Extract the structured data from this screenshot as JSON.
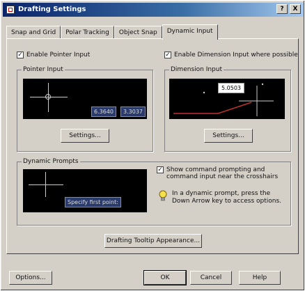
{
  "window": {
    "title": "Drafting Settings",
    "help_btn": "?",
    "close_btn": "X"
  },
  "tabs": [
    {
      "label": "Snap and Grid"
    },
    {
      "label": "Polar Tracking"
    },
    {
      "label": "Object Snap"
    },
    {
      "label": "Dynamic Input"
    }
  ],
  "pointer_input": {
    "enable_label": "Enable Pointer Input",
    "group_label": "Pointer Input",
    "coord_x": "6.3640",
    "coord_y": "3.3037",
    "settings_label": "Settings..."
  },
  "dimension_input": {
    "enable_label": "Enable Dimension Input where possible",
    "group_label": "Dimension Input",
    "value": "5.0503",
    "settings_label": "Settings..."
  },
  "dynamic_prompts": {
    "group_label": "Dynamic Prompts",
    "preview_text": "Specify first point:",
    "show_label": "Show command prompting and command input near the crosshairs",
    "hint_text": "In a dynamic prompt, press the Down Arrow key to access options."
  },
  "tooltip_button": "Drafting Tooltip Appearance...",
  "footer": {
    "options": "Options...",
    "ok": "OK",
    "cancel": "Cancel",
    "help": "Help"
  }
}
